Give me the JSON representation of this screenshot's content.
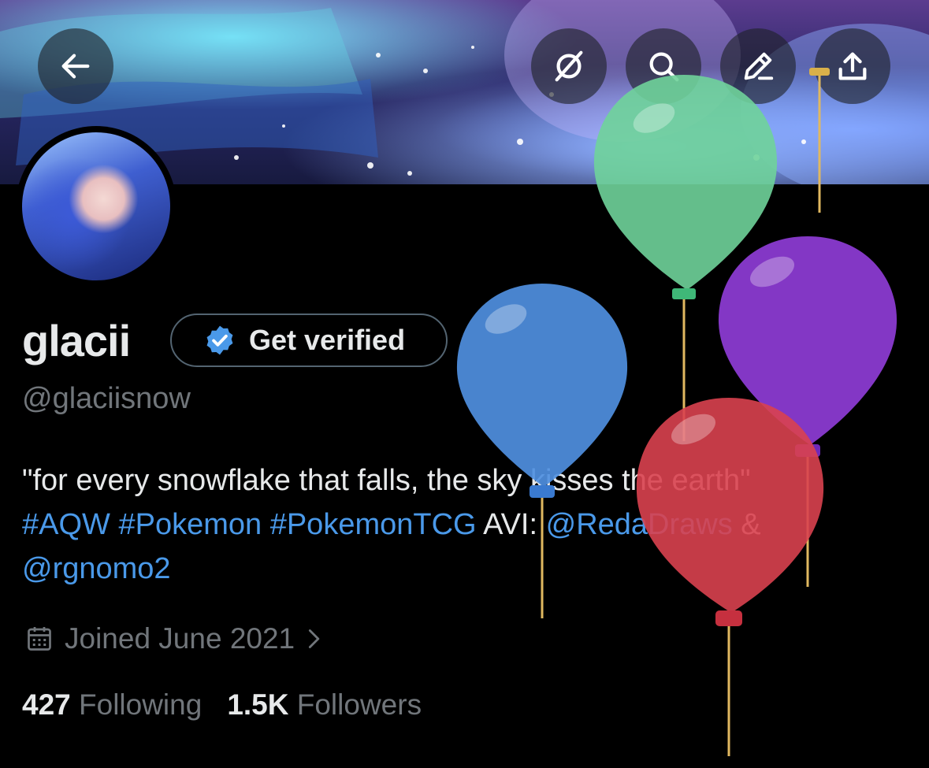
{
  "header": {
    "back_icon": "arrow-left-icon",
    "actions": [
      "circle-slash-icon",
      "search-icon",
      "edit-icon",
      "share-icon"
    ]
  },
  "profile": {
    "display_name": "glacii",
    "verify_button": "Get verified",
    "handle": "@glaciisnow",
    "bio": {
      "quote": "\"for every snowflake that falls, the sky kisses the earth\"",
      "tags": [
        "#AQW",
        "#Pokemon",
        "#PokemonTCG"
      ],
      "avi_label": "AVI:",
      "credit1": "@RedaDraws",
      "amp": "&",
      "credit2": "@rgnomo2"
    },
    "joined": "Joined June 2021",
    "stats": {
      "following_count": "427",
      "following_label": "Following",
      "followers_count": "1.5K",
      "followers_label": "Followers"
    }
  },
  "colors": {
    "accent": "#4a99e9",
    "muted": "#71767b",
    "balloon_green": "#6fd39a",
    "balloon_purple": "#8a3ad0",
    "balloon_blue": "#4f8fe0",
    "balloon_red": "#d9414f"
  }
}
